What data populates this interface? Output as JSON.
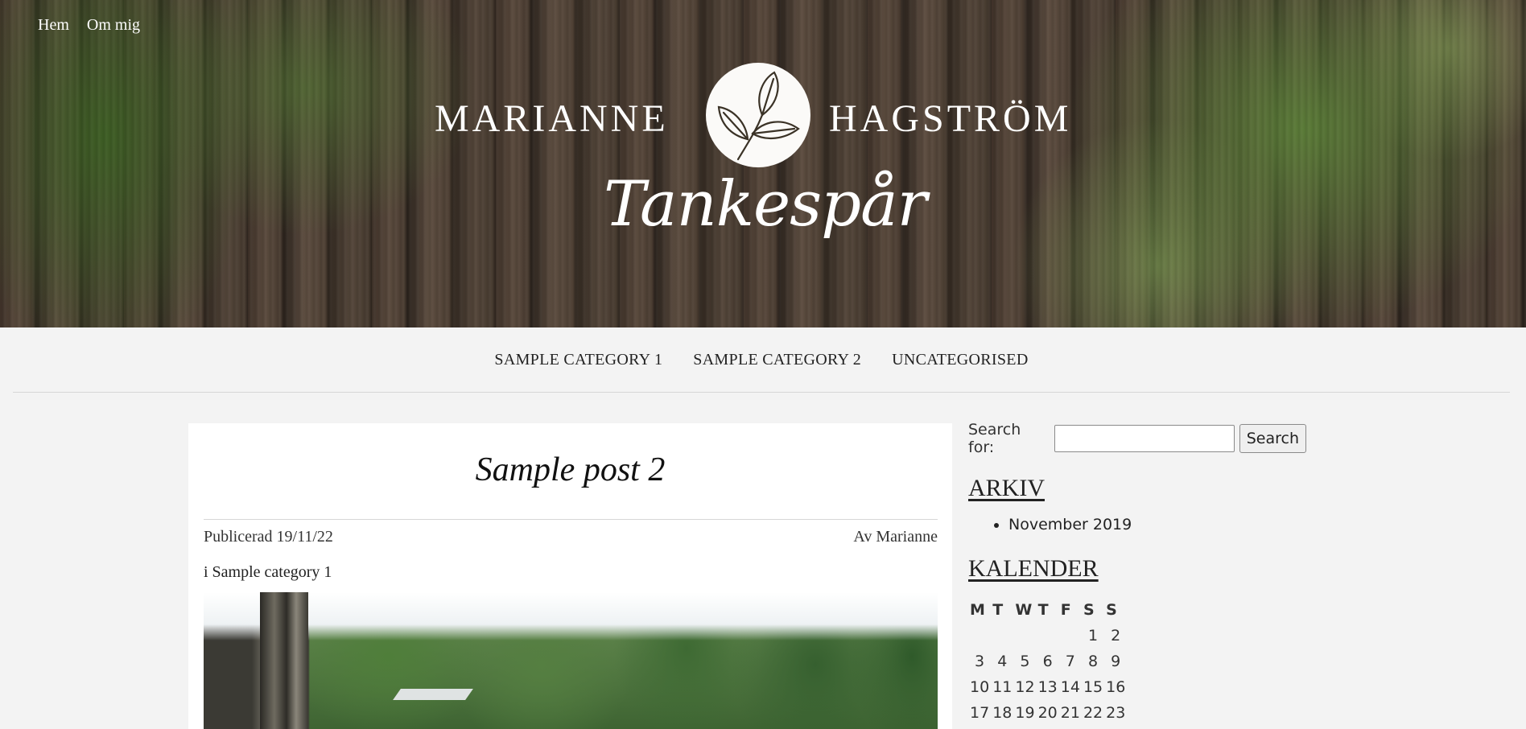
{
  "top_nav": [
    "Hem",
    "Om mig"
  ],
  "brand": {
    "first": "MARIANNE",
    "last": "HAGSTRÖM",
    "script": "Tankespår"
  },
  "categories": [
    "SAMPLE CATEGORY 1",
    "SAMPLE CATEGORY 2",
    "UNCATEGORISED"
  ],
  "post": {
    "title": "Sample post 2",
    "date": "Publicerad 19/11/22",
    "author": "Av Marianne",
    "category": "i Sample category 1"
  },
  "sidebar": {
    "search_label": "Search for:",
    "search_value": "",
    "search_button": "Search",
    "archive_title": "ARKIV",
    "archive_items": [
      "November 2019"
    ],
    "calendar_title": "KALENDER",
    "calendar_days": [
      "M",
      "T",
      "W",
      "T",
      "F",
      "S",
      "S"
    ],
    "calendar_rows": [
      [
        "",
        "",
        "",
        "",
        "",
        "1",
        "2"
      ],
      [
        "3",
        "4",
        "5",
        "6",
        "7",
        "8",
        "9"
      ],
      [
        "10",
        "11",
        "12",
        "13",
        "14",
        "15",
        "16"
      ],
      [
        "17",
        "18",
        "19",
        "20",
        "21",
        "22",
        "23"
      ]
    ]
  }
}
